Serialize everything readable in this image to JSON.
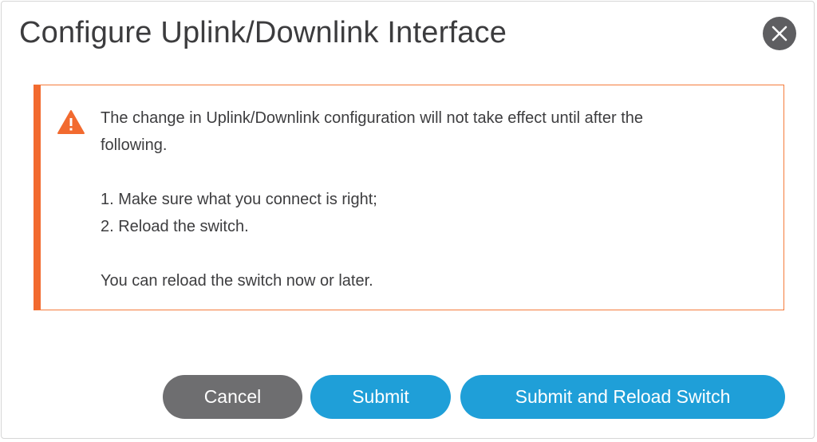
{
  "dialog": {
    "title": "Configure Uplink/Downlink Interface",
    "close_icon": "close-x-icon"
  },
  "alert": {
    "icon": "warning-triangle-icon",
    "accent_color": "#f26a2f",
    "line1": "The change in Uplink/Downlink configuration will not take effect until after the",
    "line2": "following.",
    "step1": "1. Make sure what you connect is right;",
    "step2": "2. Reload the switch.",
    "note": "You can reload the switch now or later."
  },
  "buttons": {
    "cancel": "Cancel",
    "submit": "Submit",
    "submit_reload": "Submit and Reload Switch"
  },
  "colors": {
    "primary": "#1f9fd8",
    "secondary": "#6e6e70",
    "close": "#5e5e61"
  }
}
